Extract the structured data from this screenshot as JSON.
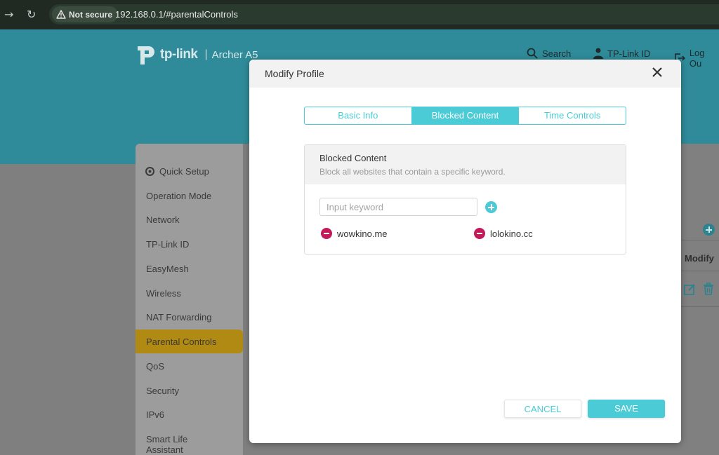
{
  "browser": {
    "security_label": "Not secure",
    "url": "192.168.0.1/#parentalControls"
  },
  "header": {
    "brand": "tp-link",
    "model": "Archer A5",
    "links": {
      "search": "Search",
      "tplink_id": "TP-Link ID",
      "logout": "Log Ou"
    }
  },
  "sidebar": {
    "items": [
      {
        "label": "Quick Setup"
      },
      {
        "label": "Operation Mode"
      },
      {
        "label": "Network"
      },
      {
        "label": "TP-Link ID"
      },
      {
        "label": "EasyMesh"
      },
      {
        "label": "Wireless"
      },
      {
        "label": "NAT Forwarding"
      },
      {
        "label": "Parental Controls",
        "active": true
      },
      {
        "label": "QoS"
      },
      {
        "label": "Security"
      },
      {
        "label": "IPv6"
      },
      {
        "label": "Smart Life Assistant"
      }
    ]
  },
  "table": {
    "modify_header": "Modify"
  },
  "modal": {
    "title": "Modify Profile",
    "tabs": [
      {
        "label": "Basic Info"
      },
      {
        "label": "Blocked Content",
        "active": true
      },
      {
        "label": "Time Controls"
      }
    ],
    "panel": {
      "title": "Blocked Content",
      "description": "Block all websites that contain a specific keyword.",
      "input_placeholder": "Input keyword",
      "input_value": "",
      "keywords": [
        "wowkino.me",
        "lolokino.cc"
      ]
    },
    "buttons": {
      "cancel": "CANCEL",
      "save": "SAVE"
    }
  },
  "colors": {
    "accent": "#4acbd6",
    "active_nav": "#b08a12",
    "remove": "#c4195b"
  }
}
